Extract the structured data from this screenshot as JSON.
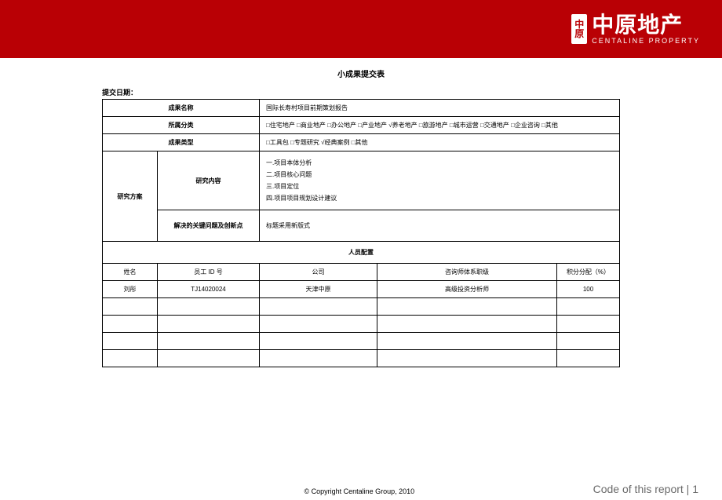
{
  "header": {
    "logo_badge_top": "中",
    "logo_badge_bottom": "原",
    "logo_cn": "中原地产",
    "logo_en": "CENTALINE PROPERTY"
  },
  "doc": {
    "title": "小成果提交表",
    "submit_date_label": "提交日期：",
    "fields": {
      "name_label": "成果名称",
      "name_value": "国际长寿村项目前期策划报告",
      "category_label": "所属分类",
      "category_value": "□住宅地产 □商业地产 □办公地产 □产业地产 √养老地产 □旅游地产 □城市运营 □交通地产 □企业咨询 □其他",
      "type_label": "成果类型",
      "type_value": "□工具包 □专题研究 √经典案例 □其他",
      "plan_label": "研究方案",
      "research_content_label": "研究内容",
      "research_lines": {
        "l1": "一.项目本体分析",
        "l2": "二.项目核心问题",
        "l3": "三.项目定位",
        "l4": "四.项目项目规划设计建议"
      },
      "key_label": "解决的关键问题及创新点",
      "key_value": "标题采用新版式"
    },
    "staff_section": {
      "title": "人员配置",
      "headers": {
        "name": "姓名",
        "id": "员工 ID 号",
        "company": "公司",
        "role": "咨询师体系职级",
        "ratio": "积分分配（%）"
      },
      "rows": [
        {
          "name": "刘彤",
          "id": "TJ14020024",
          "company": "天津中原",
          "role": "高级投资分析师",
          "ratio": "100"
        }
      ]
    }
  },
  "footer": {
    "copyright": "© Copyright  Centaline Group, 2010",
    "page_code": "Code of this report  |  1"
  }
}
